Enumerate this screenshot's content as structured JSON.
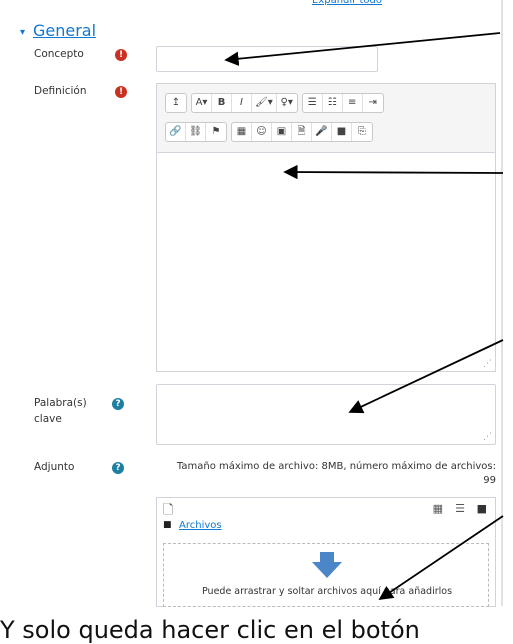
{
  "header": {
    "expand_all": "Expandir todo"
  },
  "section": {
    "title": "General",
    "caret": "▾"
  },
  "fields": {
    "concept": {
      "label": "Concepto",
      "req_icon": "!"
    },
    "definition": {
      "label": "Definición",
      "req_icon": "!"
    },
    "keywords": {
      "label_line1": "Palabra(s)",
      "label_line2": "clave",
      "help_icon": "?"
    },
    "attachment": {
      "label": "Adjunto",
      "help_icon": "?"
    }
  },
  "editor": {
    "toolbar_row1": [
      [
        "↥"
      ],
      [
        "A▾",
        "B",
        "I",
        "🖌▾",
        "♀▾"
      ],
      [
        "☰",
        "☷",
        "≡",
        "⇥"
      ]
    ],
    "toolbar_row2": [
      [
        "🔗",
        "⛓",
        "⚑"
      ],
      [
        "▦",
        "☺",
        "▣",
        "🗎",
        "🎤",
        "■",
        "⎘"
      ]
    ]
  },
  "filemanager": {
    "info_line1": "Tamaño máximo de archivo: 8MB, número máximo de archivos:",
    "info_line2": "99",
    "folder_label": "Archivos",
    "drop_text": "Puede arrastrar y soltar archivos aquí para añadirlos"
  },
  "caption": {
    "text": "Y solo queda hacer clic en el botón"
  },
  "colors": {
    "link": "#1177d1",
    "required": "#ca3120",
    "help": "#1f7fa3",
    "drop_arrow": "#4a86c8"
  }
}
